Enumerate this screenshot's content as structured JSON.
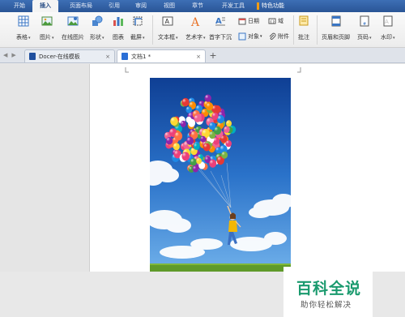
{
  "menu": {
    "items": [
      "开始",
      "插入",
      "页面布局",
      "引用",
      "审阅",
      "视图",
      "章节",
      "开发工具",
      "特色功能"
    ],
    "active_index": 1
  },
  "ribbon": {
    "large_buttons": [
      {
        "label": "表格",
        "icon": "table-icon",
        "dropdown": true
      },
      {
        "label": "图片",
        "icon": "picture-icon",
        "dropdown": true
      },
      {
        "label": "在线图片",
        "icon": "online-picture-icon",
        "dropdown": false
      },
      {
        "label": "形状",
        "icon": "shapes-icon",
        "dropdown": true
      },
      {
        "label": "图表",
        "icon": "chart-icon",
        "dropdown": false
      },
      {
        "label": "截屏",
        "icon": "screenshot-icon",
        "dropdown": true
      },
      {
        "label": "文本框",
        "icon": "textbox-icon",
        "dropdown": true
      },
      {
        "label": "艺术字",
        "icon": "wordart-icon",
        "dropdown": true
      },
      {
        "label": "首字下沉",
        "icon": "dropcap-icon",
        "dropdown": false
      },
      {
        "label": "批注",
        "icon": "comment-icon",
        "dropdown": false
      },
      {
        "label": "页眉和页脚",
        "icon": "header-footer-icon",
        "dropdown": false
      },
      {
        "label": "页码",
        "icon": "page-number-icon",
        "dropdown": true
      },
      {
        "label": "水印",
        "icon": "watermark-icon",
        "dropdown": true
      }
    ],
    "small_buttons": [
      {
        "label": "日期",
        "icon": "date-icon"
      },
      {
        "label": "对象",
        "icon": "object-icon"
      },
      {
        "label": "域",
        "icon": "field-icon"
      },
      {
        "label": "附件",
        "icon": "attachment-icon"
      }
    ],
    "dropdown_glyph": "▾"
  },
  "tabs": {
    "nav_back": "◀",
    "nav_fwd": "▶",
    "items": [
      {
        "title": "Docer-在线模板",
        "close": "×"
      },
      {
        "title": "文档1 *",
        "close": "×"
      }
    ],
    "new_tab": "+"
  },
  "watermark": {
    "title": "百科全说",
    "subtitle": "助你轻松解决"
  },
  "colors": {
    "menubar": "#2a5596",
    "docer_tab_icon": "#1f4f9e",
    "doc_tab_icon": "#2b6fd6",
    "sky_top": "#0f3f94",
    "sky_bottom": "#6fb0ea",
    "grass": "#5f9a2a",
    "watermark_green": "#1a9a6e"
  }
}
